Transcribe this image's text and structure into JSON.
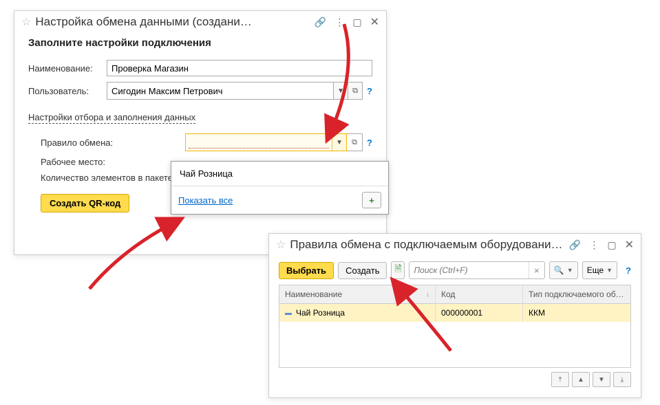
{
  "win1": {
    "title": "Настройка обмена данными (создани…",
    "heading": "Заполните настройки подключения",
    "field_name_label": "Наименование:",
    "field_name_value": "Проверка Магазин",
    "field_user_label": "Пользователь:",
    "field_user_value": "Сигодин Максим Петрович",
    "settings_link": "Настройки отбора и заполнения данных",
    "rule_label": "Правило обмена:",
    "workplace_label": "Рабочее место:",
    "packet_label": "Количество элементов в пакете:",
    "qr_btn": "Создать QR-код"
  },
  "dropdown": {
    "option1": "Чай Розница",
    "show_all": "Показать все"
  },
  "win2": {
    "title": "Правила обмена с подключаемым оборудованием …",
    "select_btn": "Выбрать",
    "create_btn": "Создать",
    "search_placeholder": "Поиск (Ctrl+F)",
    "more_btn": "Еще",
    "col_name": "Наименование",
    "col_code": "Код",
    "col_type": "Тип подключаемого об…",
    "row": {
      "name": "Чай Розница",
      "code": "000000001",
      "type": "ККМ"
    }
  }
}
